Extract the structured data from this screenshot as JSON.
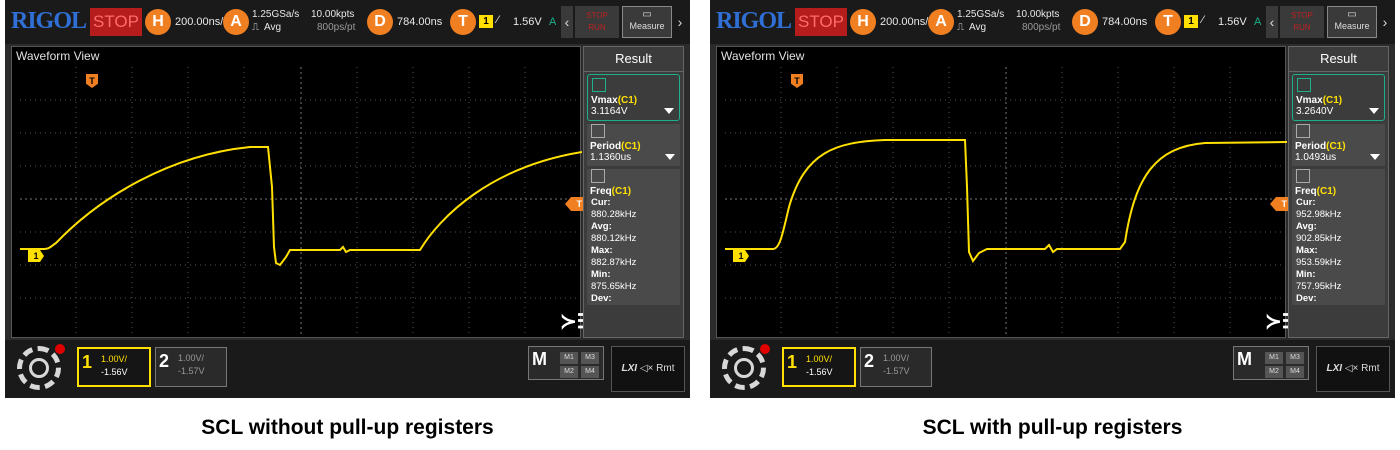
{
  "scopes": [
    {
      "brand": "RIGOL",
      "status": "STOP",
      "h_icon": "H",
      "h_value": "200.00ns/",
      "a_icon": "A",
      "sample_rate": "1.25GSa/s",
      "acq_mode": "Avg",
      "mem_depth": "10.00kpts",
      "pts_rate": "800ps/pt",
      "d_icon": "D",
      "delay": "784.00ns",
      "t_icon": "T",
      "trig_ch": "1",
      "trig_level": "1.56V",
      "trig_mode": "A",
      "run_label": "STOP\nRUN",
      "measure_label": "Measure",
      "view_title": "Waveform View",
      "trigger_marker": "T",
      "ch_marker": "1",
      "trig_level_marker": "T",
      "result_title": "Result",
      "meas1_name": "Vmax",
      "meas1_src": "(C1)",
      "meas1_value": "3.1164V",
      "meas2_name": "Period",
      "meas2_src": "(C1)",
      "meas2_value": "1.1360us",
      "meas3_name": "Freq",
      "meas3_src": "(C1)",
      "freq_cur_label": "Cur:",
      "freq_cur": "880.28kHz",
      "freq_avg_label": "Avg:",
      "freq_avg": "880.12kHz",
      "freq_max_label": "Max:",
      "freq_max": "882.87kHz",
      "freq_min_label": "Min:",
      "freq_min": "875.65kHz",
      "freq_dev_label": "Dev:",
      "ch1_num": "1",
      "ch1_scale": "1.00V/",
      "ch1_offset": "-1.56V",
      "ch2_num": "2",
      "ch2_scale": "1.00V/",
      "ch2_offset": "-1.57V",
      "math_label": "M",
      "m1": "M1",
      "m2": "M2",
      "m3": "M3",
      "m4": "M4",
      "lxi_label": "LXI",
      "mute_label": "×",
      "rmt_label": "Rmt",
      "caption": "SCL without pull-up registers",
      "colors": {
        "trace": "#ffe000",
        "accent": "#f07f22",
        "stop": "#b51d1d",
        "select": "#1bb08a"
      }
    },
    {
      "brand": "RIGOL",
      "status": "STOP",
      "h_icon": "H",
      "h_value": "200.00ns/",
      "a_icon": "A",
      "sample_rate": "1.25GSa/s",
      "acq_mode": "Avg",
      "mem_depth": "10.00kpts",
      "pts_rate": "800ps/pt",
      "d_icon": "D",
      "delay": "784.00ns",
      "t_icon": "T",
      "trig_ch": "1",
      "trig_level": "1.56V",
      "trig_mode": "A",
      "run_label": "STOP\nRUN",
      "measure_label": "Measure",
      "view_title": "Waveform View",
      "trigger_marker": "T",
      "ch_marker": "1",
      "trig_level_marker": "T",
      "result_title": "Result",
      "meas1_name": "Vmax",
      "meas1_src": "(C1)",
      "meas1_value": "3.2640V",
      "meas2_name": "Period",
      "meas2_src": "(C1)",
      "meas2_value": "1.0493us",
      "meas3_name": "Freq",
      "meas3_src": "(C1)",
      "freq_cur_label": "Cur:",
      "freq_cur": "952.98kHz",
      "freq_avg_label": "Avg:",
      "freq_avg": "902.85kHz",
      "freq_max_label": "Max:",
      "freq_max": "953.59kHz",
      "freq_min_label": "Min:",
      "freq_min": "757.95kHz",
      "freq_dev_label": "Dev:",
      "ch1_num": "1",
      "ch1_scale": "1.00V/",
      "ch1_offset": "-1.56V",
      "ch2_num": "2",
      "ch2_scale": "1.00V/",
      "ch2_offset": "-1.57V",
      "math_label": "M",
      "m1": "M1",
      "m2": "M2",
      "m3": "M3",
      "m4": "M4",
      "lxi_label": "LXI",
      "mute_label": "×",
      "rmt_label": "Rmt",
      "caption": "SCL with pull-up registers",
      "colors": {
        "trace": "#ffe000",
        "accent": "#f07f22",
        "stop": "#b51d1d",
        "select": "#1bb08a"
      }
    }
  ]
}
